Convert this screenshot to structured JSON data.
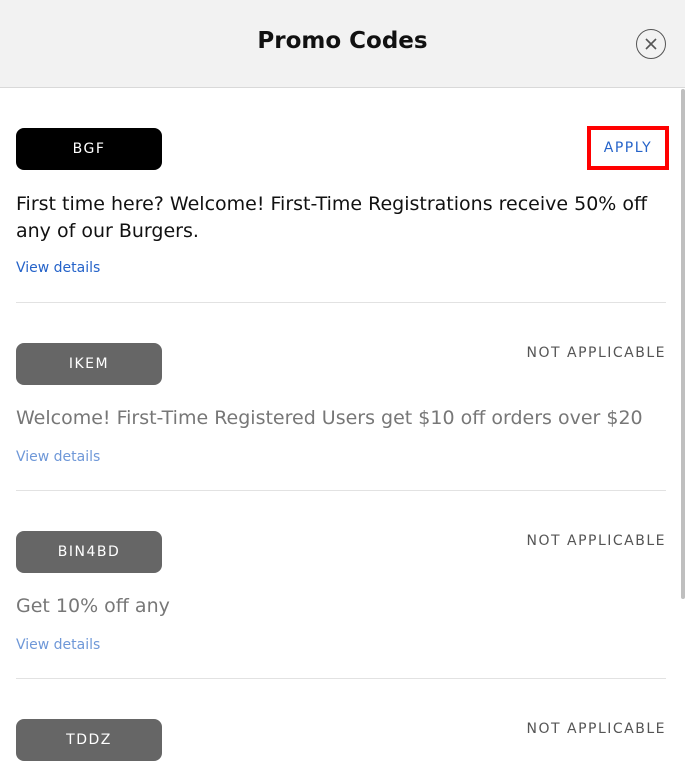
{
  "header": {
    "title": "Promo Codes",
    "close_icon": "close-icon"
  },
  "promos": [
    {
      "code": "BGF",
      "action": "APPLY",
      "description": "First time here? Welcome! First-Time Registrations receive 50% off any of our Burgers.",
      "details_link": "View details",
      "applicable": true
    },
    {
      "code": "IKEM",
      "action": "NOT APPLICABLE",
      "description": "Welcome! First-Time Registered Users get $10 off orders over $20",
      "details_link": "View details",
      "applicable": false
    },
    {
      "code": "BIN4BD",
      "action": "NOT APPLICABLE",
      "description": "Get 10% off any",
      "details_link": "View details",
      "applicable": false
    },
    {
      "code": "TDDZ",
      "action": "NOT APPLICABLE",
      "applicable": false
    }
  ],
  "colors": {
    "link": "#2563c9",
    "highlight": "#ff0000",
    "pill_active": "#000000",
    "pill_inactive": "#666666"
  }
}
